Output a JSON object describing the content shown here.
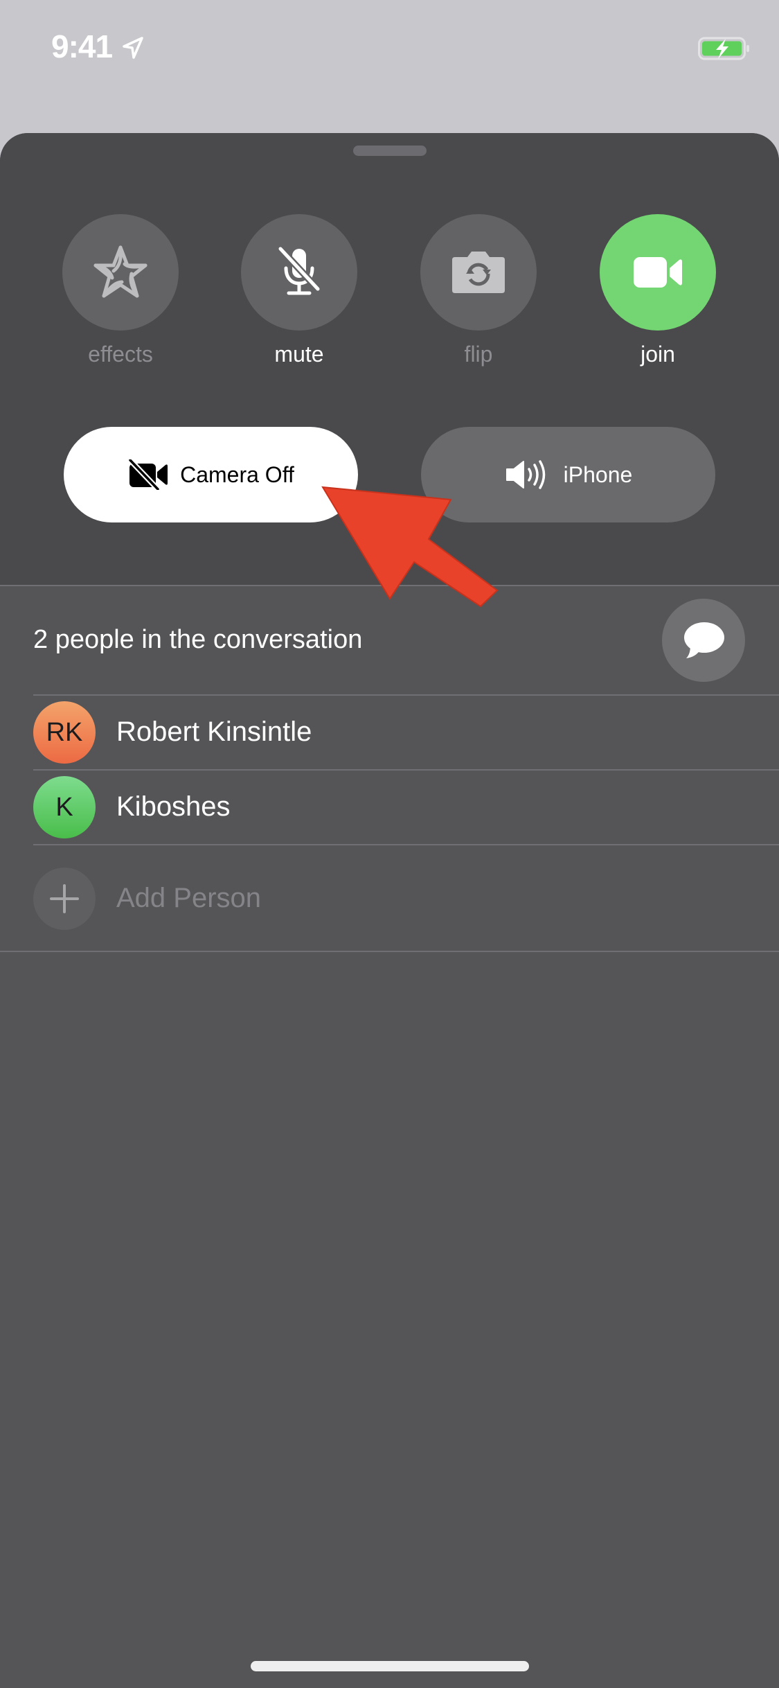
{
  "status_bar": {
    "time": "9:41",
    "location_icon": "location-arrow-icon",
    "battery_icon": "battery-charging-icon",
    "battery_color": "#5ed05b"
  },
  "controls": [
    {
      "id": "effects",
      "label": "effects",
      "icon": "effects-star-icon",
      "enabled": false
    },
    {
      "id": "mute",
      "label": "mute",
      "icon": "mic-slash-icon",
      "enabled": true
    },
    {
      "id": "flip",
      "label": "flip",
      "icon": "camera-flip-icon",
      "enabled": false
    },
    {
      "id": "join",
      "label": "join",
      "icon": "video-camera-icon",
      "enabled": true,
      "color": "#73d672"
    }
  ],
  "pills": {
    "camera": {
      "label": "Camera Off",
      "icon": "video-slash-icon",
      "selected": true
    },
    "audio": {
      "label": "iPhone",
      "icon": "speaker-wave-icon",
      "selected": false
    }
  },
  "conversation": {
    "title": "2 people in the conversation",
    "message_button_icon": "message-bubble-icon",
    "people": [
      {
        "initials": "RK",
        "name": "Robert Kinsintle",
        "avatar_color": "#ef7b4e"
      },
      {
        "initials": "K",
        "name": "Kiboshes",
        "avatar_color": "#5ccb62"
      }
    ],
    "add_person": {
      "label": "Add Person",
      "icon": "plus-icon"
    }
  },
  "annotation": {
    "type": "arrow",
    "color": "#e8422a",
    "points_to": "camera-off-button"
  }
}
